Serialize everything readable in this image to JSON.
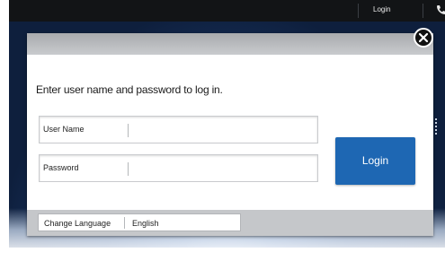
{
  "topbar": {
    "login_label": "Login",
    "phone_icon": "phone-icon"
  },
  "dialog": {
    "prompt": "Enter user name and password to log in.",
    "close_icon": "close-icon",
    "username": {
      "label": "User Name",
      "value": ""
    },
    "password": {
      "label": "Password",
      "value": ""
    },
    "login_button": "Login"
  },
  "footer": {
    "language_label": "Change Language",
    "language_value": "English"
  },
  "colors": {
    "accent": "#1e67b3",
    "topbar": "#121416",
    "background": "#0e1f3d"
  }
}
